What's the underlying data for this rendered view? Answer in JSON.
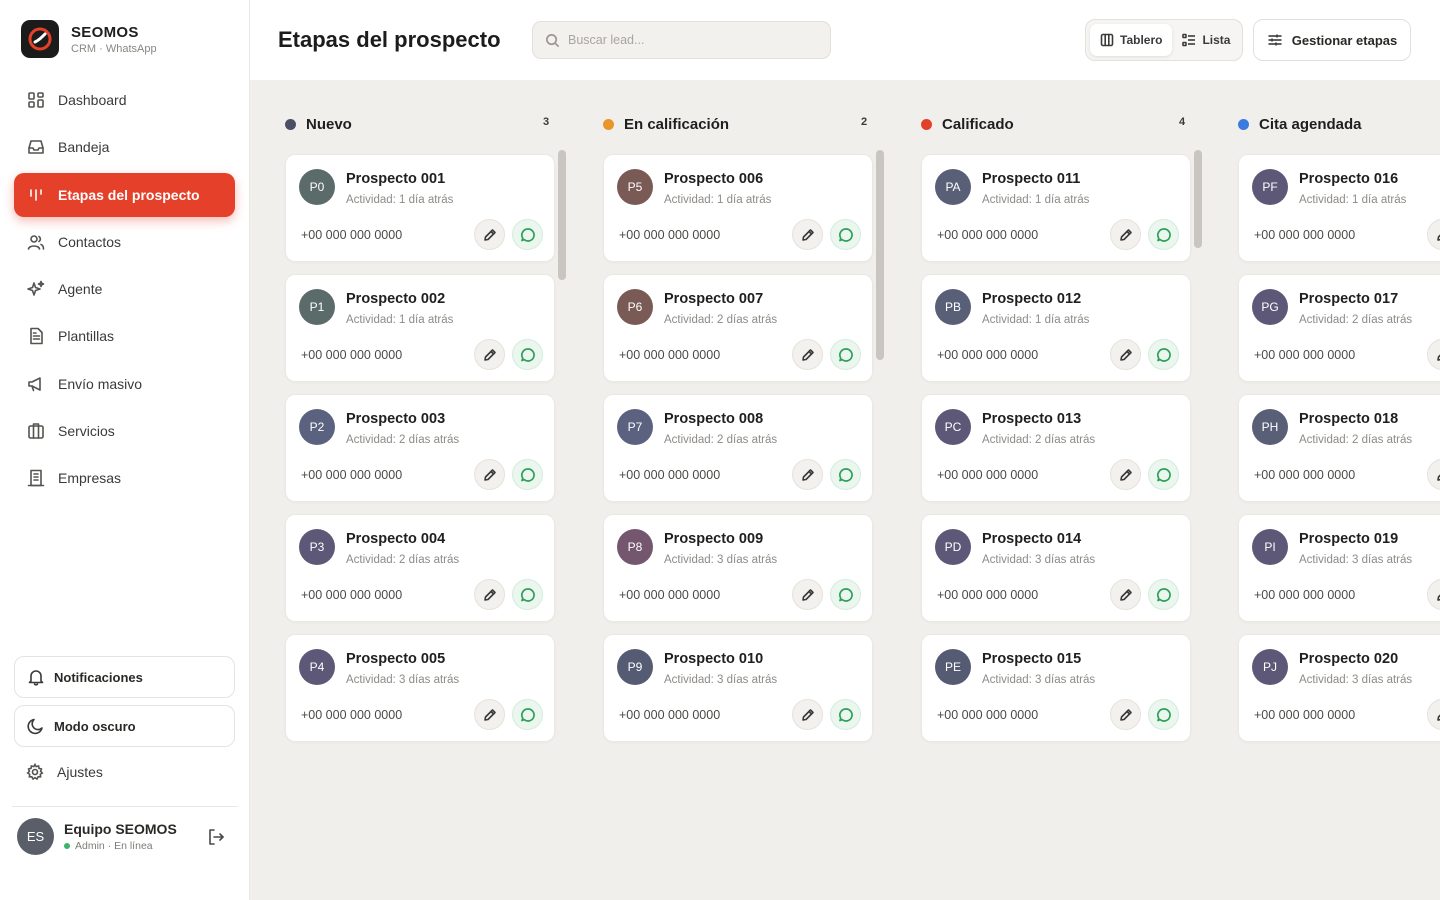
{
  "brand": {
    "name": "SEOMOS",
    "subtitle": "CRM · WhatsApp"
  },
  "nav": [
    {
      "label": "Dashboard",
      "icon": "grid-icon",
      "active": false
    },
    {
      "label": "Bandeja",
      "icon": "inbox-icon",
      "active": false
    },
    {
      "label": "Etapas del prospecto",
      "icon": "kanban-icon",
      "active": true
    },
    {
      "label": "Contactos",
      "icon": "users-icon",
      "active": false
    },
    {
      "label": "Agente",
      "icon": "sparkles-icon",
      "active": false
    },
    {
      "label": "Plantillas",
      "icon": "document-icon",
      "active": false
    },
    {
      "label": "Envío masivo",
      "icon": "megaphone-icon",
      "active": false
    },
    {
      "label": "Servicios",
      "icon": "briefcase-icon",
      "active": false
    },
    {
      "label": "Empresas",
      "icon": "building-icon",
      "active": false
    }
  ],
  "sidebar_bottom": {
    "notifications": "Notificaciones",
    "dark_mode": "Modo oscuro",
    "settings": "Ajustes"
  },
  "user": {
    "initials": "ES",
    "name": "Equipo SEOMOS",
    "status": "Admin · En línea"
  },
  "header": {
    "title": "Etapas del prospecto",
    "search_placeholder": "Buscar lead...",
    "view_board": "Tablero",
    "view_list": "Lista",
    "manage": "Gestionar etapas"
  },
  "colors": {
    "accent": "#e4402a",
    "online": "#3bb56a",
    "whatsapp": "#2ea05a"
  },
  "columns": [
    {
      "title": "Nuevo",
      "count": "3",
      "color": "#4a4f63",
      "leads": [
        {
          "initials": "P0",
          "name": "Prospecto 001",
          "activity": "Actividad: 1 día atrás",
          "phone": "+00 000 000 0000",
          "avatar": "#5b6b6a"
        },
        {
          "initials": "P1",
          "name": "Prospecto 002",
          "activity": "Actividad: 1 día atrás",
          "phone": "+00 000 000 0000",
          "avatar": "#5b6b6a"
        },
        {
          "initials": "P2",
          "name": "Prospecto 003",
          "activity": "Actividad: 2 días atrás",
          "phone": "+00 000 000 0000",
          "avatar": "#5a6280"
        },
        {
          "initials": "P3",
          "name": "Prospecto 004",
          "activity": "Actividad: 2 días atrás",
          "phone": "+00 000 000 0000",
          "avatar": "#5d5878"
        },
        {
          "initials": "P4",
          "name": "Prospecto 005",
          "activity": "Actividad: 3 días atrás",
          "phone": "+00 000 000 0000",
          "avatar": "#5d5878"
        }
      ]
    },
    {
      "title": "En calificación",
      "count": "2",
      "color": "#e8962a",
      "leads": [
        {
          "initials": "P5",
          "name": "Prospecto 006",
          "activity": "Actividad: 1 día atrás",
          "phone": "+00 000 000 0000",
          "avatar": "#7a5a55"
        },
        {
          "initials": "P6",
          "name": "Prospecto 007",
          "activity": "Actividad: 2 días atrás",
          "phone": "+00 000 000 0000",
          "avatar": "#7a5a55"
        },
        {
          "initials": "P7",
          "name": "Prospecto 008",
          "activity": "Actividad: 2 días atrás",
          "phone": "+00 000 000 0000",
          "avatar": "#5a6280"
        },
        {
          "initials": "P8",
          "name": "Prospecto 009",
          "activity": "Actividad: 3 días atrás",
          "phone": "+00 000 000 0000",
          "avatar": "#74566e"
        },
        {
          "initials": "P9",
          "name": "Prospecto 010",
          "activity": "Actividad: 3 días atrás",
          "phone": "+00 000 000 0000",
          "avatar": "#565b74"
        }
      ]
    },
    {
      "title": "Calificado",
      "count": "4",
      "color": "#e0402c",
      "leads": [
        {
          "initials": "PA",
          "name": "Prospecto 011",
          "activity": "Actividad: 1 día atrás",
          "phone": "+00 000 000 0000",
          "avatar": "#5a5f78"
        },
        {
          "initials": "PB",
          "name": "Prospecto 012",
          "activity": "Actividad: 1 día atrás",
          "phone": "+00 000 000 0000",
          "avatar": "#5a5f78"
        },
        {
          "initials": "PC",
          "name": "Prospecto 013",
          "activity": "Actividad: 2 días atrás",
          "phone": "+00 000 000 0000",
          "avatar": "#5d5878"
        },
        {
          "initials": "PD",
          "name": "Prospecto 014",
          "activity": "Actividad: 3 días atrás",
          "phone": "+00 000 000 0000",
          "avatar": "#5d5878"
        },
        {
          "initials": "PE",
          "name": "Prospecto 015",
          "activity": "Actividad: 3 días atrás",
          "phone": "+00 000 000 0000",
          "avatar": "#565b74"
        }
      ]
    },
    {
      "title": "Cita agendada",
      "count": "",
      "color": "#3b7be0",
      "leads": [
        {
          "initials": "PF",
          "name": "Prospecto 016",
          "activity": "Actividad: 1 día atrás",
          "phone": "+00 000 000 0000",
          "avatar": "#5d5878"
        },
        {
          "initials": "PG",
          "name": "Prospecto 017",
          "activity": "Actividad: 2 días atrás",
          "phone": "+00 000 000 0000",
          "avatar": "#5d5878"
        },
        {
          "initials": "PH",
          "name": "Prospecto 018",
          "activity": "Actividad: 2 días atrás",
          "phone": "+00 000 000 0000",
          "avatar": "#5a5f78"
        },
        {
          "initials": "PI",
          "name": "Prospecto 019",
          "activity": "Actividad: 3 días atrás",
          "phone": "+00 000 000 0000",
          "avatar": "#5d5878"
        },
        {
          "initials": "PJ",
          "name": "Prospecto 020",
          "activity": "Actividad: 3 días atrás",
          "phone": "+00 000 000 0000",
          "avatar": "#5d5878"
        }
      ]
    }
  ]
}
